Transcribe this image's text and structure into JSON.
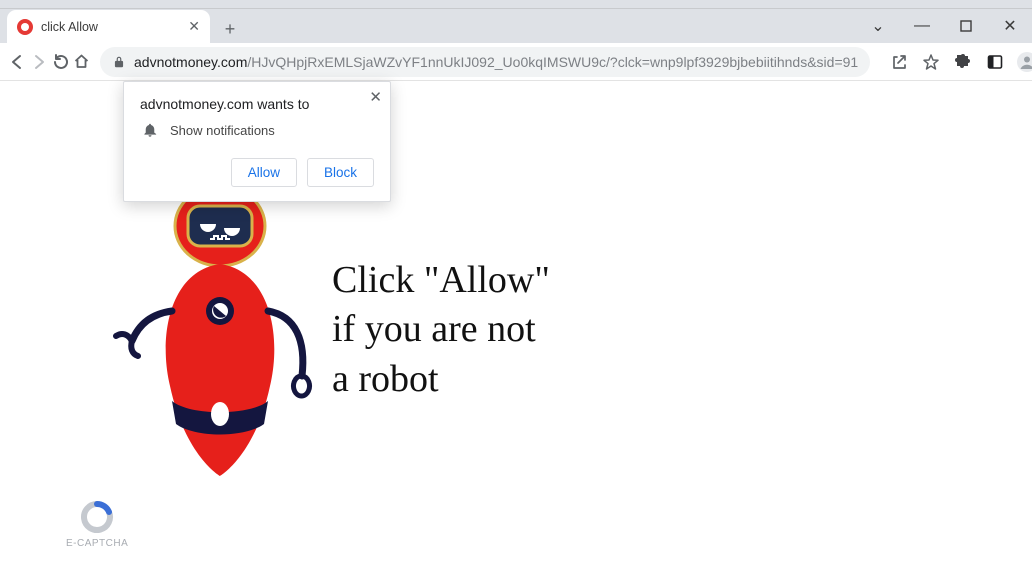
{
  "window": {
    "controls": {
      "min": "—",
      "max": "▢",
      "close": "✕",
      "chevron": "⌄"
    }
  },
  "tab": {
    "title": "click Allow"
  },
  "toolbar": {
    "url_host": "advnotmoney.com",
    "url_path": "/HJvQHpjRxEMLSjaWZvYF1nnUkIJ092_Uo0kqIMSWU9c/?clck=wnp9lpf3929bjbebiitihnds&sid=91"
  },
  "prompt": {
    "title": "advnotmoney.com wants to",
    "permission": "Show notifications",
    "allow": "Allow",
    "block": "Block"
  },
  "page": {
    "line1": "Click \"Allow\"",
    "line2": "if you are not",
    "line3": "a robot",
    "captcha_label": "E-CAPTCHA"
  }
}
